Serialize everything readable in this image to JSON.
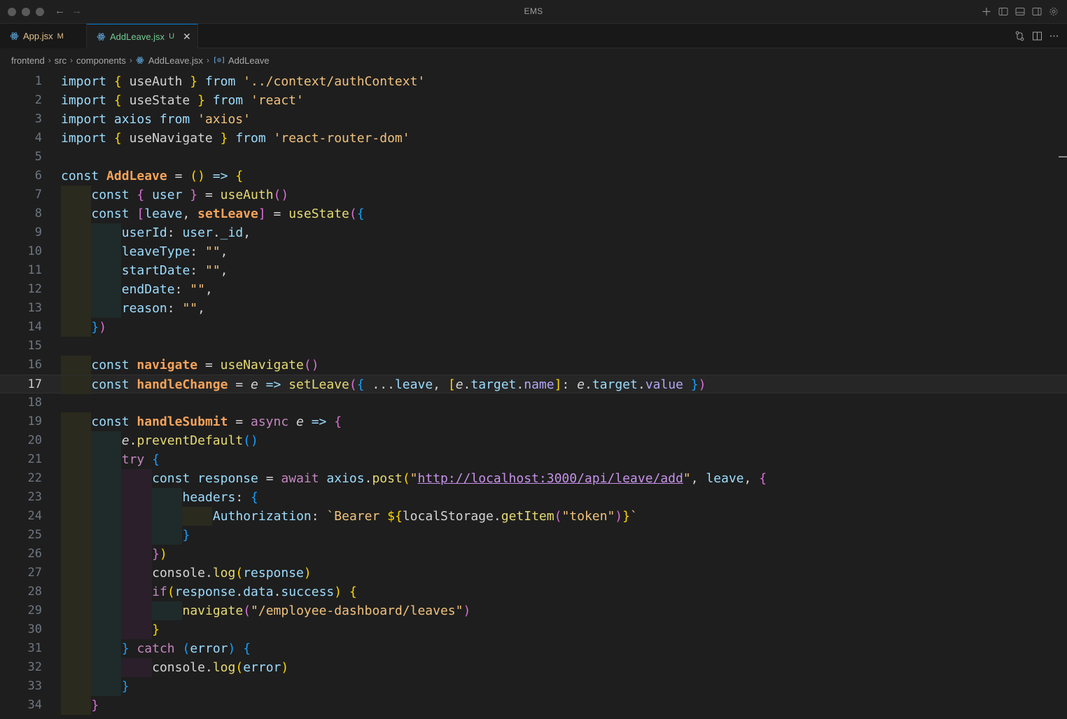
{
  "window": {
    "title": "EMS"
  },
  "tabs": [
    {
      "label": "App.jsx",
      "badge": "M"
    },
    {
      "label": "AddLeave.jsx",
      "badge": "U",
      "close": "✕"
    }
  ],
  "breadcrumb": {
    "items": [
      "frontend",
      "src",
      "components",
      "AddLeave.jsx",
      "AddLeave"
    ],
    "separator": "›",
    "symbol_glyph": "[⊙]"
  },
  "editor": {
    "current_line": 17,
    "line_numbers": [
      "1",
      "2",
      "3",
      "4",
      "5",
      "6",
      "7",
      "8",
      "9",
      "10",
      "11",
      "12",
      "13",
      "14",
      "15",
      "16",
      "17",
      "18",
      "19",
      "20",
      "21",
      "22",
      "23",
      "24",
      "25",
      "26",
      "27",
      "28",
      "29",
      "30",
      "31",
      "32",
      "33",
      "34"
    ],
    "lines": [
      "import { useAuth } from '../context/authContext'",
      "import { useState } from 'react'",
      "import axios from 'axios'",
      "import { useNavigate } from 'react-router-dom'",
      "",
      "const AddLeave = () => {",
      "    const { user } = useAuth()",
      "    const [leave, setLeave] = useState({",
      "        userId: user._id,",
      "        leaveType: \"\",",
      "        startDate: \"\",",
      "        endDate: \"\",",
      "        reason: \"\",",
      "    })",
      "",
      "    const navigate = useNavigate()",
      "    const handleChange = e => setLeave({ ...leave, [e.target.name]: e.target.value })",
      "",
      "    const handleSubmit = async e => {",
      "        e.preventDefault()",
      "        try {",
      "            const response = await axios.post(\"http://localhost:3000/api/leave/add\", leave, {",
      "                headers: {",
      "                    Authorization: `Bearer ${localStorage.getItem(\"token\")}`",
      "                }",
      "            })",
      "            console.log(response)",
      "            if(response.data.success) {",
      "                navigate(\"/employee-dashboard/leaves\")",
      "            }",
      "        } catch (error) {",
      "            console.log(error)",
      "        }",
      "    }"
    ]
  },
  "colors": {
    "accent": "#0078d4",
    "modified": "#e2c08d",
    "untracked": "#73c991"
  },
  "icons": [
    "back-arrow-icon",
    "forward-arrow-icon",
    "react-icon",
    "close-icon",
    "symbol-icon",
    "add-icon",
    "layout-icon",
    "panel-icon",
    "sidebar-icon",
    "gear-icon",
    "source-control-icon",
    "split-editor-icon",
    "more-icon"
  ]
}
